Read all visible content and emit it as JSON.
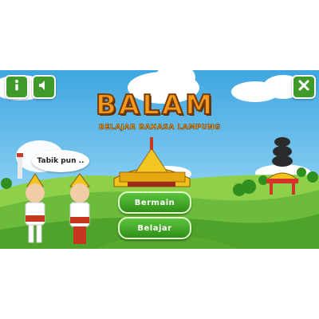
{
  "app": {
    "title": "BALAM",
    "subtitle": "BELAJAR BAHASA LAMPUNG"
  },
  "speech_bubble": {
    "text": "Tabik pun .."
  },
  "menu": {
    "play_label": "Bermain",
    "learn_label": "Belajar"
  },
  "icons": {
    "info": "info-icon",
    "sound": "speaker-icon",
    "close": "close-icon"
  },
  "colors": {
    "button_green": "#3f9a2a",
    "title_orange": "#f39a1e",
    "sky": "#3fa6e0",
    "grass": "#6dbb3c"
  }
}
